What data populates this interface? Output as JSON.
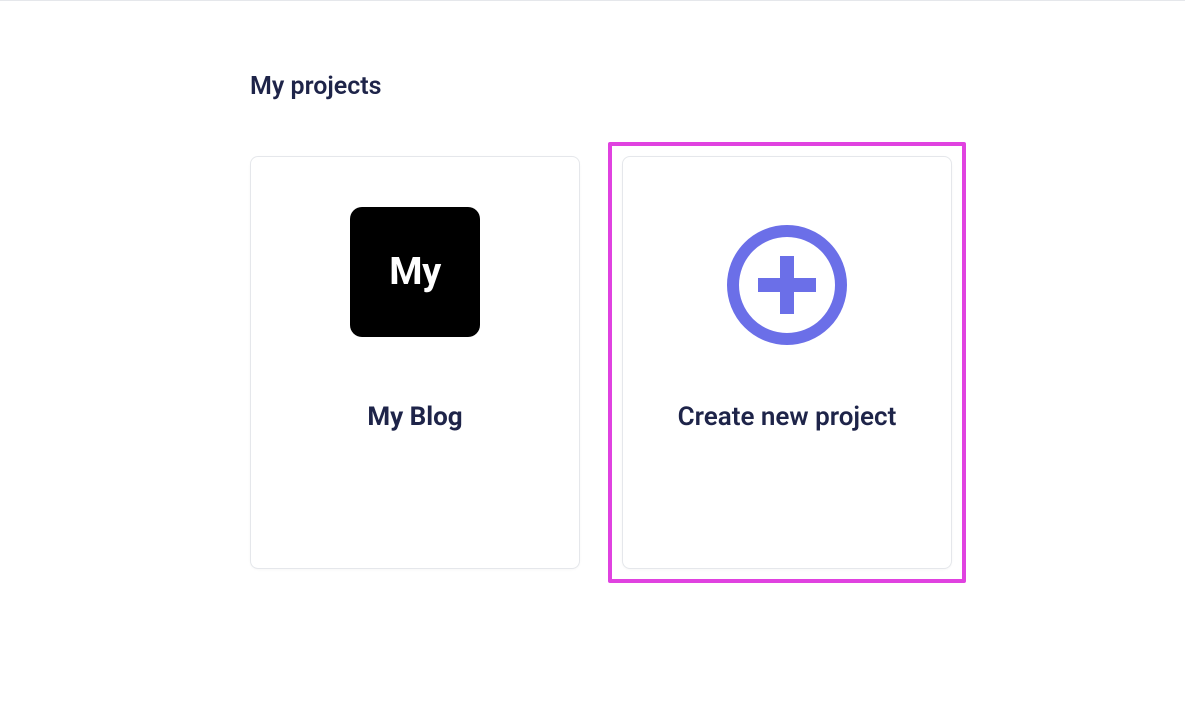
{
  "page": {
    "title": "My projects"
  },
  "projects": [
    {
      "thumb_text": "My",
      "title": "My Blog"
    }
  ],
  "create_card": {
    "label": "Create new project"
  },
  "colors": {
    "accent": "#6b6fe8",
    "highlight": "#e042e0",
    "text": "#1e2449"
  }
}
